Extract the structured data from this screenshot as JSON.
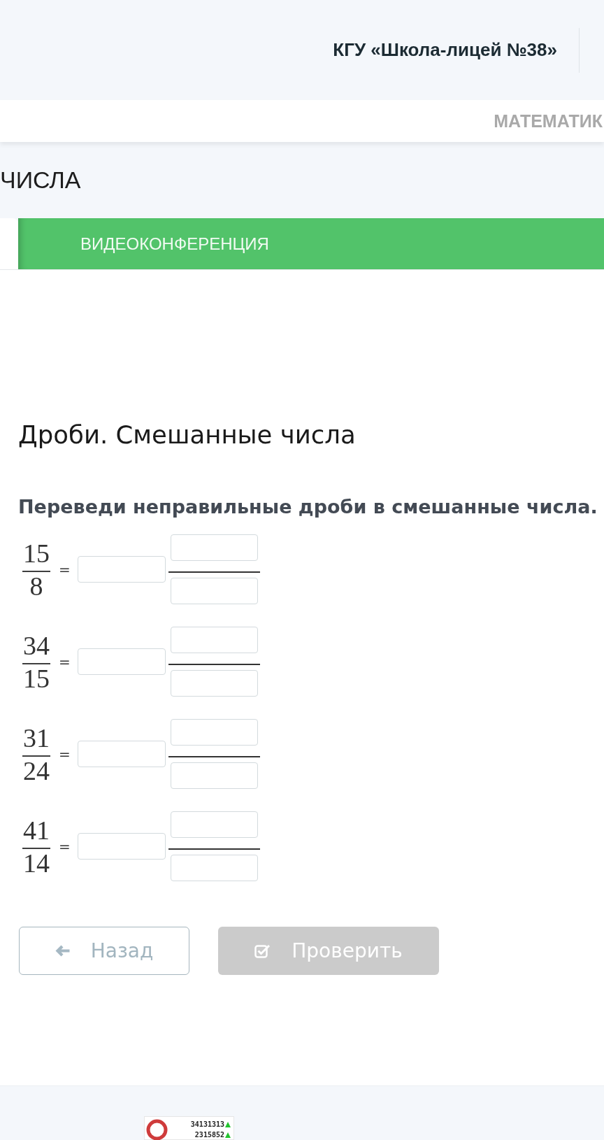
{
  "header": {
    "school": "КГУ «Школа-лицей №38»"
  },
  "subject_bar": {
    "subject": "МАТЕМАТИК"
  },
  "section": {
    "title": "ЧИСЛА"
  },
  "tabs": [
    {
      "selected": true
    },
    {
      "label": "ВИДЕОКОНФЕРЕНЦИЯ",
      "selected": false
    }
  ],
  "lesson": {
    "title": "Дроби. Смешанные числа",
    "instruction": "Переведи неправильные дроби в смешанные числа.",
    "exercises": [
      {
        "numerator": "15",
        "denominator": "8",
        "sign": "="
      },
      {
        "numerator": "34",
        "denominator": "15",
        "sign": "="
      },
      {
        "numerator": "31",
        "denominator": "24",
        "sign": "="
      },
      {
        "numerator": "41",
        "denominator": "14",
        "sign": "="
      }
    ]
  },
  "buttons": [
    {
      "kind": "back",
      "label": "Назад",
      "disabled": false
    },
    {
      "kind": "check",
      "label": "Проверить",
      "disabled": true
    }
  ],
  "footer": {
    "counter": [
      "34131313",
      "2315852"
    ]
  }
}
